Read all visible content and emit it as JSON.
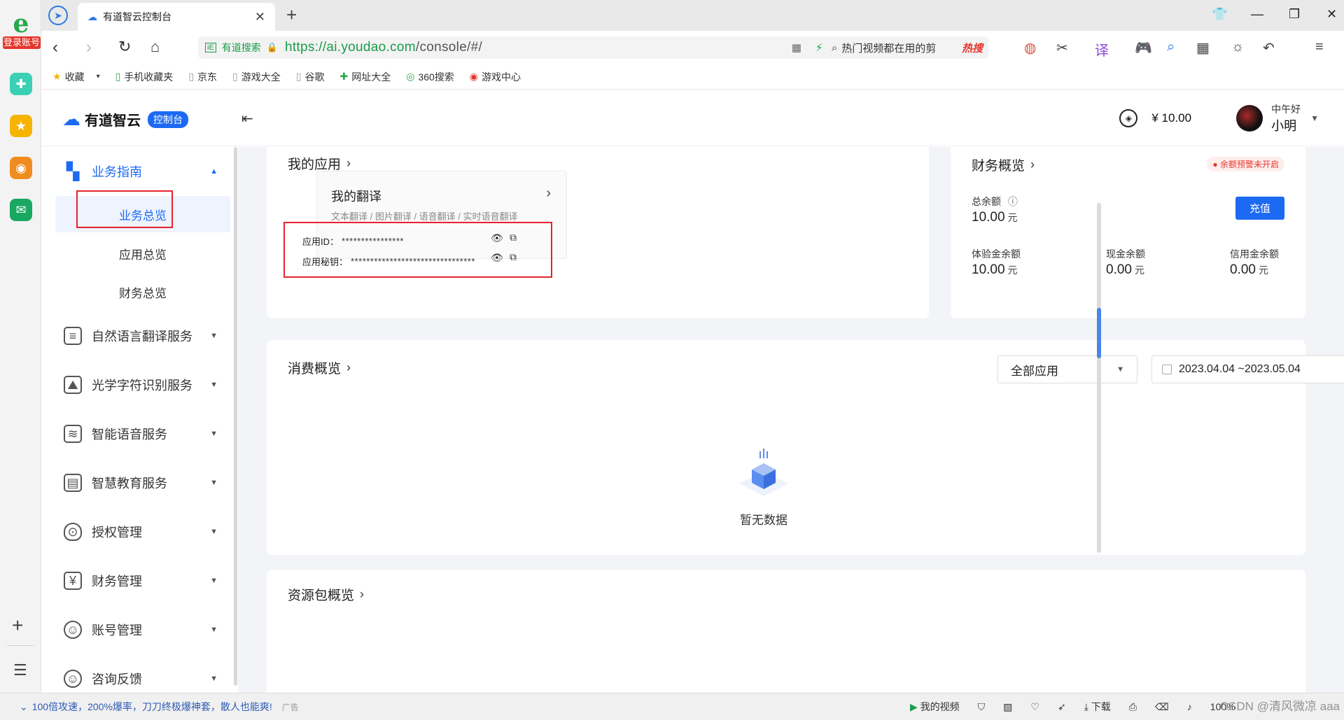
{
  "rail": {
    "logo_label": "登录账号",
    "colors": {
      "green": "#3ad0b4",
      "yellow": "#f6b400",
      "weibo": "#f08c1f",
      "mail": "#19a862"
    }
  },
  "browser": {
    "tab_title": "有道智云控制台",
    "url_prefix": "https://",
    "url_host": "ai.youdao.com",
    "url_path": "/console/#/",
    "search_engine_label": "有道搜索",
    "search_placeholder": "热门视频都在用的剪",
    "search_hot": "热搜",
    "bookmarks": [
      "收藏",
      "手机收藏夹",
      "京东",
      "游戏大全",
      "谷歌",
      "网址大全",
      "360搜索",
      "游戏中心"
    ]
  },
  "header": {
    "brand_name": "有道智云",
    "brand_badge": "控制台",
    "balance": "¥ 10.00",
    "greeting": "中午好",
    "username": "小明"
  },
  "sidebar": {
    "guide": "业务指南",
    "sub": [
      "业务总览",
      "应用总览",
      "财务总览"
    ],
    "items": [
      {
        "label": "自然语言翻译服务"
      },
      {
        "label": "光学字符识别服务"
      },
      {
        "label": "智能语音服务"
      },
      {
        "label": "智慧教育服务"
      },
      {
        "label": "授权管理"
      },
      {
        "label": "财务管理"
      },
      {
        "label": "账号管理"
      },
      {
        "label": "咨询反馈"
      }
    ]
  },
  "my_apps": {
    "title": "我的应用",
    "card_title": "我的翻译",
    "card_desc": "文本翻译 / 图片翻译 / 语音翻译 / 实时语音翻译",
    "app_id_label": "应用ID：",
    "app_id_value": "****************",
    "app_secret_label": "应用秘钥：",
    "app_secret_value": "********************************"
  },
  "finance": {
    "title": "财务概览",
    "warning": "● 余额预警未开启",
    "total_label": "总余额",
    "total_value": "10.00",
    "unit": "元",
    "charge": "充值",
    "trial_label": "体验金余额",
    "trial_value": "10.00",
    "cash_label": "现金余额",
    "cash_value": "0.00",
    "credit_label": "信用金余额",
    "credit_value": "0.00"
  },
  "consumption": {
    "title": "消费概览",
    "select_value": "全部应用",
    "date_range": "2023.04.04 ~2023.05.04",
    "empty": "暂无数据"
  },
  "package": {
    "title": "资源包概览"
  },
  "statusbar": {
    "news": "100倍攻速，200%爆率，刀刀终极爆神套，散人也能爽!",
    "ad": "广告",
    "my_video": "我的视频",
    "download": "下载",
    "zoom": "100%",
    "watermark": "CSDN @清风微凉 aaa"
  }
}
